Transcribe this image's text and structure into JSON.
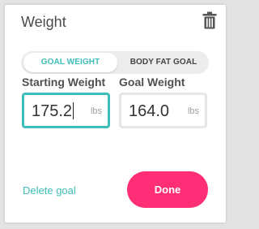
{
  "dialog": {
    "title": "Weight"
  },
  "toggle": {
    "options": [
      {
        "label": "GOAL WEIGHT",
        "selected": true
      },
      {
        "label": "BODY FAT GOAL",
        "selected": false
      }
    ]
  },
  "starting_weight": {
    "label": "Starting Weight",
    "value": "175.2",
    "unit": "lbs"
  },
  "goal_weight": {
    "label": "Goal Weight",
    "value": "164.0",
    "unit": "lbs"
  },
  "actions": {
    "delete_label": "Delete goal",
    "done_label": "Done"
  },
  "icons": {
    "trash": "trash-icon"
  },
  "colors": {
    "accent_teal": "#3fbdb8",
    "done_pink": "#ff2e76",
    "backdrop": "#e3e3e3"
  }
}
